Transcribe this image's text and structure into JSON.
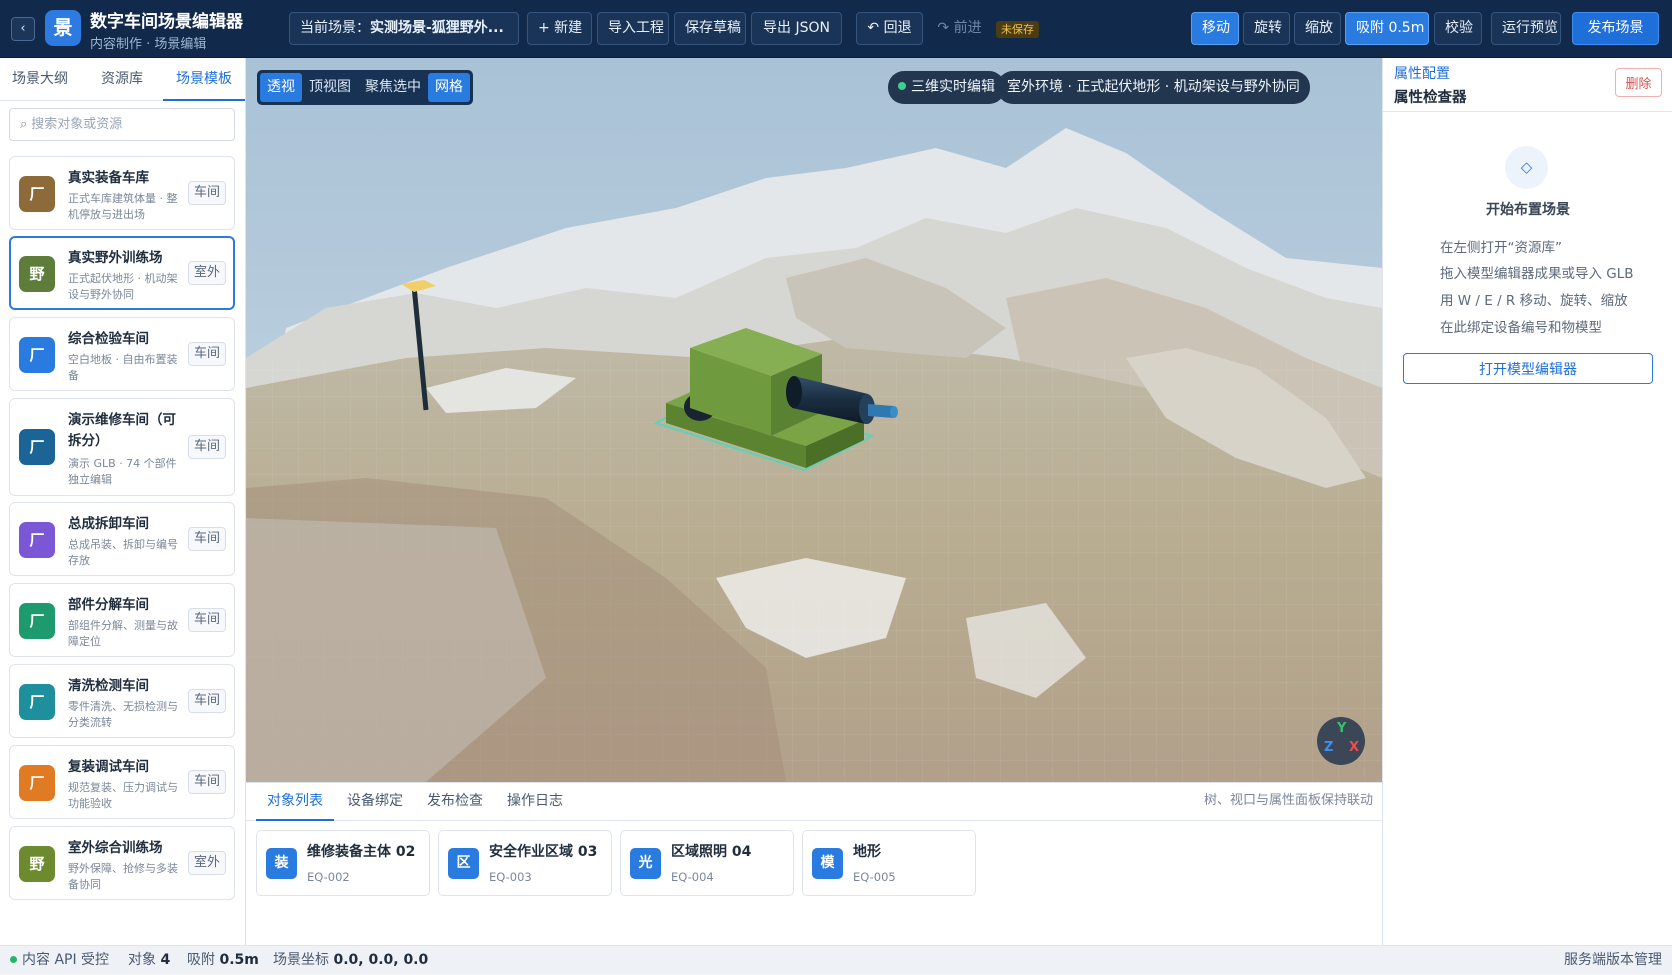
{
  "app": {
    "logo_char": "景",
    "title": "数字车间场景编辑器",
    "subtitle": "内容制作 · 场景编辑",
    "back_glyph": "‹"
  },
  "toolbar": {
    "scene_prefix": "当前场景：",
    "scene_name": "实测场景-狐狸野外...",
    "new_label": "+ 新建",
    "import_label": "导入工程",
    "save_draft_label": "保存草稿",
    "export_label": "导出 JSON",
    "undo_label": "↶ 回退",
    "redo_label": "↷ 前进",
    "unsaved_label": "未保存",
    "move_label": "移动",
    "rotate_label": "旋转",
    "scale_label": "缩放",
    "snap_label": "吸附 0.5m",
    "validate_label": "校验",
    "preview_label": "运行预览",
    "publish_label": "发布场景"
  },
  "left": {
    "tabs": [
      "场景大纲",
      "资源库",
      "场景模板"
    ],
    "active_tab": 2,
    "search_icon": "⌕",
    "search_placeholder": "搜索对象或资源",
    "templates": [
      {
        "icon": "厂",
        "color": "#8c6a3a",
        "name": "真实装备车库",
        "desc": "正式车库建筑体量 · 整机停放与进出场",
        "tag": "车间"
      },
      {
        "icon": "野",
        "color": "#5e7d3a",
        "name": "真实野外训练场",
        "desc": "正式起伏地形 · 机动架设与野外协同",
        "tag": "室外"
      },
      {
        "icon": "厂",
        "color": "#2a7be0",
        "name": "综合检验车间",
        "desc": "空白地板 · 自由布置装备",
        "tag": "车间"
      },
      {
        "icon": "厂",
        "color": "#1a6496",
        "name": "演示维修车间（可拆分）",
        "desc": "演示 GLB · 74 个部件独立编辑",
        "tag": "车间"
      },
      {
        "icon": "厂",
        "color": "#7b57d6",
        "name": "总成拆卸车间",
        "desc": "总成吊装、拆卸与编号存放",
        "tag": "车间"
      },
      {
        "icon": "厂",
        "color": "#1f9a6e",
        "name": "部件分解车间",
        "desc": "部组件分解、测量与故障定位",
        "tag": "车间"
      },
      {
        "icon": "厂",
        "color": "#1e8f9c",
        "name": "清洗检测车间",
        "desc": "零件清洗、无损检测与分类流转",
        "tag": "车间"
      },
      {
        "icon": "厂",
        "color": "#e07b24",
        "name": "复装调试车间",
        "desc": "规范复装、压力调试与功能验收",
        "tag": "车间"
      },
      {
        "icon": "野",
        "color": "#6d8a2e",
        "name": "室外综合训练场",
        "desc": "野外保障、抢修与多装备协同",
        "tag": "室外"
      }
    ]
  },
  "viewport": {
    "view_buttons": [
      "透视",
      "顶视图",
      "聚焦选中",
      "网格"
    ],
    "live_badge": "三维实时编辑",
    "env_badge": "室外环境 · 正式起伏地形 · 机动架设与野外协同",
    "axis": {
      "x": "X",
      "y": "Y",
      "z": "Z"
    }
  },
  "bottom": {
    "tabs": [
      "对象列表",
      "设备绑定",
      "发布检查",
      "操作日志"
    ],
    "note": "树、视口与属性面板保持联动",
    "objects": [
      {
        "icon": "装",
        "name": "维修装备主体 02",
        "id": "EQ-002"
      },
      {
        "icon": "区",
        "name": "安全作业区域 03",
        "id": "EQ-003"
      },
      {
        "icon": "光",
        "name": "区域照明 04",
        "id": "EQ-004"
      },
      {
        "icon": "模",
        "name": "地形",
        "id": "EQ-005"
      }
    ]
  },
  "right": {
    "kicker": "属性配置",
    "title": "属性检查器",
    "delete_label": "删除",
    "empty_icon": "◇",
    "empty_title": "开始布置场景",
    "tips": [
      "在左侧打开“资源库”",
      "拖入模型编辑器成果或导入 GLB",
      "用 W / E / R 移动、旋转、缩放",
      "在此绑定设备编号和物模型"
    ],
    "open_editor_label": "打开模型编辑器"
  },
  "status": {
    "api": "内容 API 受控",
    "objects_label": "对象",
    "objects_value": "4",
    "snap_label": "吸附",
    "snap_value": "0.5m",
    "coord_label": "场景坐标",
    "coord_value": "0.0, 0.0, 0.0",
    "version_label": "服务端版本管理"
  },
  "colors": {
    "accent": "#2a7be0",
    "topbar": "#11294a",
    "danger": "#d9534f",
    "vehicle": "#5f8a32"
  }
}
